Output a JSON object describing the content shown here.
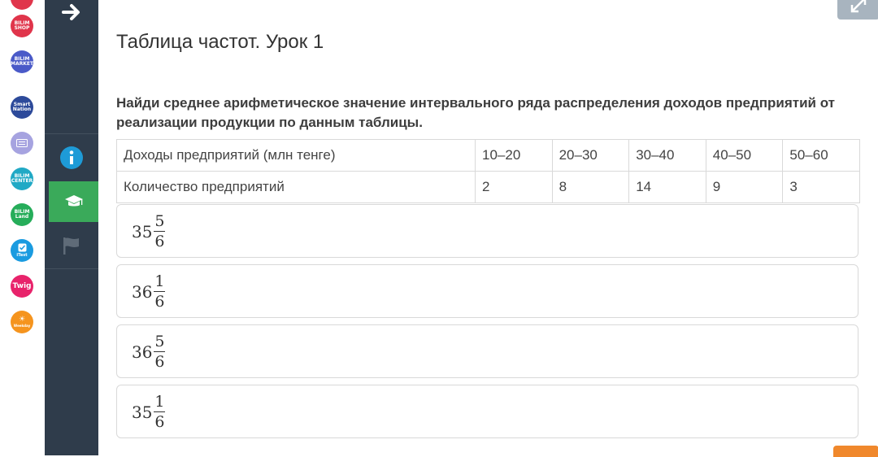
{
  "colors": {
    "sidebar": "#2f3c4b",
    "sidebar_active": "#3aaa5a",
    "info_icon": "#1e9bd7",
    "app_bilimshop": "#e0354b",
    "app_bilimmarket": "#4a5ac8",
    "app_smartnation": "#2d4a9a",
    "app_keyboard": "#a6a3e0",
    "app_bilimcenter": "#21a9c5",
    "app_bilimland": "#26ad5a",
    "app_itest": "#1a9be0",
    "app_twig": "#e8236b",
    "app_weekday": "#f5941e"
  },
  "app_rail": {
    "items": [
      {
        "name": "bilim-shop",
        "text": "BILIM\nSHOP"
      },
      {
        "name": "bilim-market",
        "text": "BILIM\nMARKET"
      },
      {
        "name": "smart-nation",
        "text": "Smart\nNation"
      },
      {
        "name": "keyboard-app",
        "text": ""
      },
      {
        "name": "bilim-center",
        "text": "BILIM\nCENTER"
      },
      {
        "name": "bilim-land",
        "text": "BILIM\nLand"
      },
      {
        "name": "itest",
        "text": "iTest"
      },
      {
        "name": "twig",
        "text": "Twig"
      },
      {
        "name": "weekday",
        "text": "Weekday"
      }
    ]
  },
  "sidebar": {
    "icons": [
      "arrow-right-icon",
      "info-icon",
      "graduation-cap-icon",
      "flag-icon"
    ],
    "active": "graduation-cap-icon"
  },
  "page": {
    "title": "Таблица частот. Урок 1",
    "question": "Найди среднее арифметическое значение интервального ряда распределения доходов предприятий от реализации продукции по данным таблицы."
  },
  "table": {
    "rows": [
      {
        "header": "Доходы предприятий (млн тенге)",
        "cells": [
          "10–20",
          "20–30",
          "30–40",
          "40–50",
          "50–60"
        ]
      },
      {
        "header": "Количество предприятий",
        "cells": [
          "2",
          "8",
          "14",
          "9",
          "3"
        ]
      }
    ]
  },
  "answers": [
    {
      "whole": "35",
      "num": "5",
      "den": "6"
    },
    {
      "whole": "36",
      "num": "1",
      "den": "6"
    },
    {
      "whole": "36",
      "num": "5",
      "den": "6"
    },
    {
      "whole": "35",
      "num": "1",
      "den": "6"
    }
  ]
}
